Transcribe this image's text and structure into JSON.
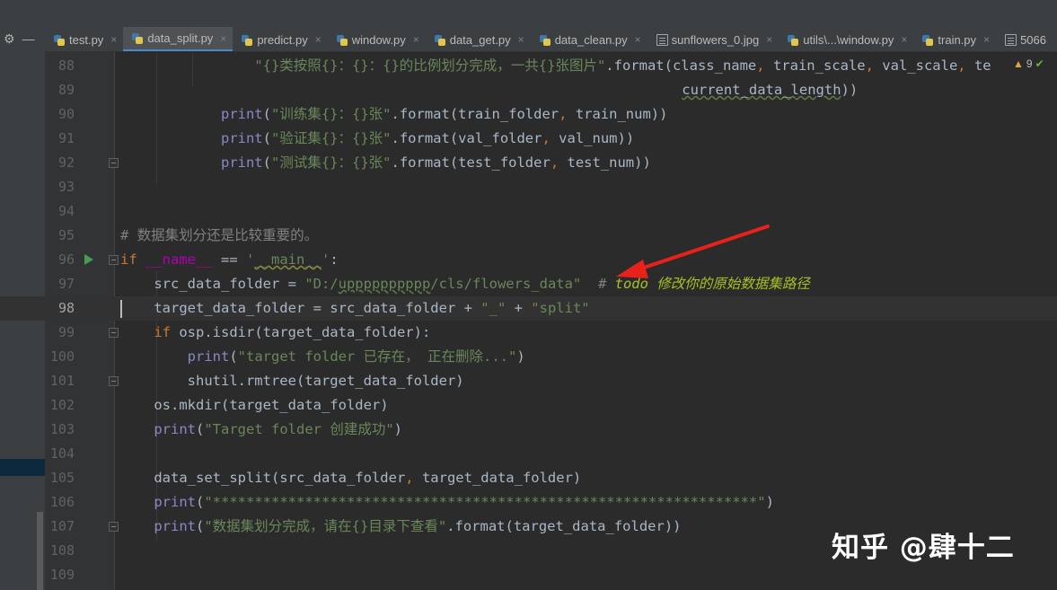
{
  "tabs": [
    {
      "label": "test.py",
      "icon": "python-file-icon",
      "active": false
    },
    {
      "label": "data_split.py",
      "icon": "python-file-icon",
      "active": true
    },
    {
      "label": "predict.py",
      "icon": "python-file-icon",
      "active": false
    },
    {
      "label": "window.py",
      "icon": "python-file-icon",
      "active": false
    },
    {
      "label": "data_get.py",
      "icon": "python-file-icon",
      "active": false
    },
    {
      "label": "data_clean.py",
      "icon": "python-file-icon",
      "active": false
    },
    {
      "label": "sunflowers_0.jpg",
      "icon": "image-file-icon",
      "active": false
    },
    {
      "label": "utils\\...\\window.py",
      "icon": "python-file-icon",
      "active": false
    },
    {
      "label": "train.py",
      "icon": "python-file-icon",
      "active": false
    },
    {
      "label": "5066",
      "icon": "image-file-icon",
      "active": false
    }
  ],
  "tab_close_glyph": "×",
  "inspections": {
    "warnings": "9",
    "ok_icon": "check-icon"
  },
  "lines": [
    {
      "num": "88",
      "code": "                \"{}类按照{}：{}：{}的比例划分完成，一共{}张图片\".format(class_name, train_scale, val_scale, te"
    },
    {
      "num": "89",
      "code": "                                                                   current_data_length))"
    },
    {
      "num": "90",
      "code": "            print(\"训练集{}：{}张\".format(train_folder, train_num))"
    },
    {
      "num": "91",
      "code": "            print(\"验证集{}：{}张\".format(val_folder, val_num))"
    },
    {
      "num": "92",
      "code": "            print(\"测试集{}：{}张\".format(test_folder, test_num))"
    },
    {
      "num": "93",
      "code": ""
    },
    {
      "num": "94",
      "code": ""
    },
    {
      "num": "95",
      "code": "# 数据集划分还是比较重要的。"
    },
    {
      "num": "96",
      "code": "if __name__ == '__main__':"
    },
    {
      "num": "97",
      "code": "    src_data_folder = \"D:/upppppppppp/cls/flowers_data\"  # todo 修改你的原始数据集路径"
    },
    {
      "num": "98",
      "code": "    target_data_folder = src_data_folder + \"_\" + \"split\""
    },
    {
      "num": "99",
      "code": "    if osp.isdir(target_data_folder):"
    },
    {
      "num": "100",
      "code": "        print(\"target folder 已存在， 正在删除...\")"
    },
    {
      "num": "101",
      "code": "        shutil.rmtree(target_data_folder)"
    },
    {
      "num": "102",
      "code": "    os.mkdir(target_data_folder)"
    },
    {
      "num": "103",
      "code": "    print(\"Target folder 创建成功\")"
    },
    {
      "num": "104",
      "code": ""
    },
    {
      "num": "105",
      "code": "    data_set_split(src_data_folder, target_data_folder)"
    },
    {
      "num": "106",
      "code": "    print(\"*****************************************************************\")"
    },
    {
      "num": "107",
      "code": "    print(\"数据集划分完成，请在{}目录下查看\".format(target_data_folder))"
    },
    {
      "num": "108",
      "code": ""
    },
    {
      "num": "109",
      "code": ""
    }
  ],
  "current_line": "98",
  "watermark": "知乎 @肆十二",
  "colors": {
    "keyword": "#cc7832",
    "string": "#6a8759",
    "builtin": "#8888c6",
    "comment": "#808080",
    "todo": "#a8c023",
    "annotation_arrow": "#e8221b"
  }
}
